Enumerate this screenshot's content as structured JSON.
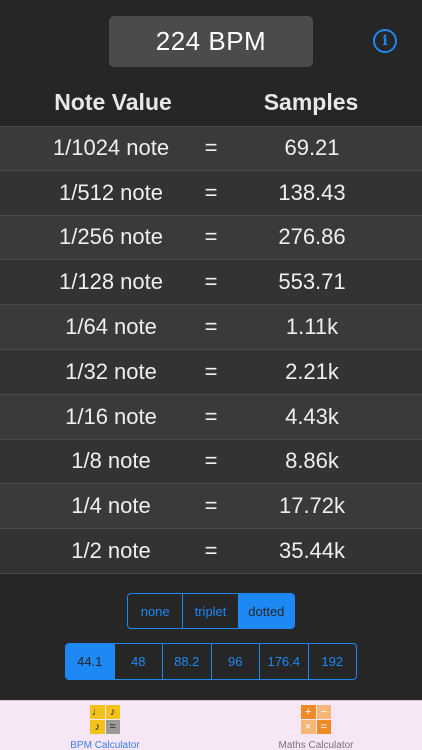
{
  "bpm_display": "224 BPM",
  "info_icon": "i",
  "headers": {
    "note_value": "Note Value",
    "samples": "Samples"
  },
  "rows": [
    {
      "note": "1/1024 note",
      "eq": "=",
      "value": "69.21"
    },
    {
      "note": "1/512 note",
      "eq": "=",
      "value": "138.43"
    },
    {
      "note": "1/256 note",
      "eq": "=",
      "value": "276.86"
    },
    {
      "note": "1/128 note",
      "eq": "=",
      "value": "553.71"
    },
    {
      "note": "1/64 note",
      "eq": "=",
      "value": "1.11k"
    },
    {
      "note": "1/32 note",
      "eq": "=",
      "value": "2.21k"
    },
    {
      "note": "1/16 note",
      "eq": "=",
      "value": "4.43k"
    },
    {
      "note": "1/8 note",
      "eq": "=",
      "value": "8.86k"
    },
    {
      "note": "1/4 note",
      "eq": "=",
      "value": "17.72k"
    },
    {
      "note": "1/2 note",
      "eq": "=",
      "value": "35.44k"
    }
  ],
  "tuplet_options": [
    "none",
    "triplet",
    "dotted"
  ],
  "tuplet_selected": "dotted",
  "sample_rate_options": [
    "44.1",
    "48",
    "88.2",
    "96",
    "176.4",
    "192"
  ],
  "sample_rate_selected": "44.1",
  "tabs": {
    "bpm": "BPM Calculator",
    "maths": "Maths Calculator"
  },
  "bpm_icon_glyphs": [
    "♩",
    "♪",
    "♪",
    "="
  ],
  "maths_icon_glyphs": [
    "+",
    "−",
    "×",
    "="
  ],
  "colors": {
    "accent": "#1e88f5",
    "background": "#262626",
    "tab_bar": "#f7e6f5"
  }
}
